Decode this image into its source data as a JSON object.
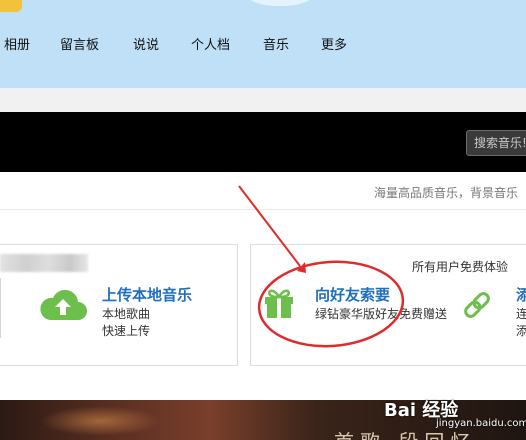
{
  "nav": {
    "items": [
      {
        "label": "相册"
      },
      {
        "label": "留言板"
      },
      {
        "label": "说说"
      },
      {
        "label": "个人档"
      },
      {
        "label": "音乐"
      },
      {
        "label": "更多"
      }
    ]
  },
  "music_bar": {
    "search_placeholder": "搜索音乐!"
  },
  "slogan": "海量高品质音乐，背景音乐",
  "cards": {
    "upload": {
      "title": "上传本地音乐",
      "line1": "本地歌曲",
      "line2": "快速上传",
      "icon": "cloud-upload-icon"
    },
    "gift": {
      "badge": "所有用户免费体验",
      "title": "向好友索要",
      "subtitle": "绿钻豪华版好友免费赠送",
      "icon": "gift-icon"
    },
    "third": {
      "title": "添",
      "line1": "连",
      "line2": "添",
      "icon": "link-icon"
    }
  },
  "banner": {
    "text": "首歌 段回忆"
  },
  "watermark": {
    "logo": "Bai 经验",
    "url": "jingyan.baidu.com"
  },
  "colors": {
    "header_bg": "#bfe0f7",
    "accent_blue": "#1f6fbf",
    "icon_green": "#6bbf4a",
    "annotation_red": "#e02b2b"
  }
}
